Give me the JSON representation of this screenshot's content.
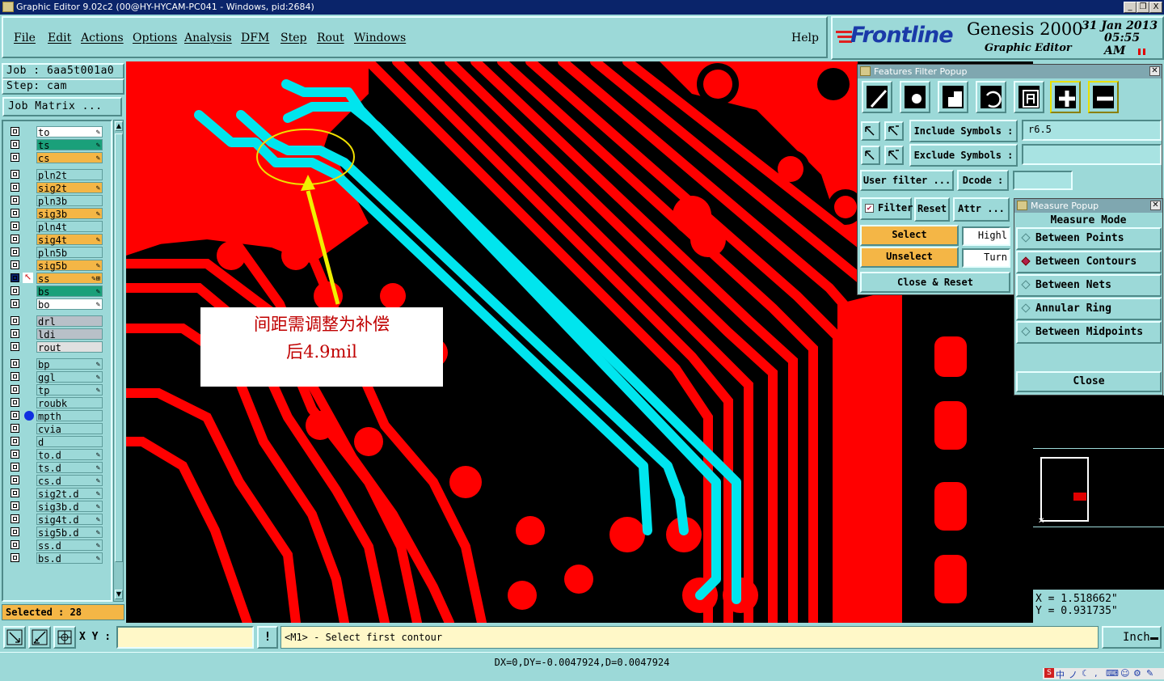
{
  "window": {
    "title": "Graphic Editor 9.02c2 (00@HY-HYCAM-PC041 - Windows, pid:2684)",
    "minimize": "_",
    "restore": "❐",
    "close": "X"
  },
  "menu": {
    "items": [
      "File",
      "Edit",
      "Actions",
      "Options",
      "Analysis",
      "DFM",
      "Step",
      "Rout",
      "Windows"
    ],
    "help": "Help"
  },
  "brand": {
    "logo": "Frontline",
    "product": "Genesis 2000",
    "subtitle": "Graphic Editor",
    "date": "31 Jan 2013",
    "time": "05:55 AM"
  },
  "left_panel": {
    "job": "Job : 6aa5t001a0",
    "step": "Step: cam",
    "job_matrix": "Job Matrix ...",
    "layers": [
      {
        "name": "to",
        "bg": "#ffffff",
        "flag": "✎"
      },
      {
        "name": "ts",
        "bg": "#1aa07a",
        "flag": "✎"
      },
      {
        "name": "cs",
        "bg": "#f4b646",
        "flag": "✎"
      },
      {
        "name": "pln2t",
        "bg": "#9cd9d8",
        "flag": ""
      },
      {
        "name": "sig2t",
        "bg": "#f4b646",
        "flag": "✎"
      },
      {
        "name": "pln3b",
        "bg": "#9cd9d8",
        "flag": ""
      },
      {
        "name": "sig3b",
        "bg": "#f4b646",
        "flag": "✎"
      },
      {
        "name": "pln4t",
        "bg": "#9cd9d8",
        "flag": ""
      },
      {
        "name": "sig4t",
        "bg": "#f4b646",
        "flag": "✎"
      },
      {
        "name": "pln5b",
        "bg": "#9cd9d8",
        "flag": ""
      },
      {
        "name": "sig5b",
        "bg": "#f4b646",
        "flag": "✎"
      },
      {
        "name": "ss",
        "bg": "#f4b646",
        "flag": "✎⊞"
      },
      {
        "name": "bs",
        "bg": "#1aa07a",
        "flag": "✎"
      },
      {
        "name": "bo",
        "bg": "#ffffff",
        "flag": "✎"
      },
      {
        "name": "drl",
        "bg": "#b8c0c8",
        "flag": ""
      },
      {
        "name": "ldi",
        "bg": "#b8c0c8",
        "flag": ""
      },
      {
        "name": "rout",
        "bg": "#e0e0e0",
        "flag": ""
      },
      {
        "name": "bp",
        "bg": "#9cd9d8",
        "flag": "✎"
      },
      {
        "name": "ggl",
        "bg": "#9cd9d8",
        "flag": "✎"
      },
      {
        "name": "tp",
        "bg": "#9cd9d8",
        "flag": "✎"
      },
      {
        "name": "roubk",
        "bg": "#9cd9d8",
        "flag": ""
      },
      {
        "name": "mpth",
        "bg": "#9cd9d8",
        "flag": ""
      },
      {
        "name": "cvia",
        "bg": "#9cd9d8",
        "flag": ""
      },
      {
        "name": "d",
        "bg": "#9cd9d8",
        "flag": ""
      },
      {
        "name": "to.d",
        "bg": "#9cd9d8",
        "flag": "✎"
      },
      {
        "name": "ts.d",
        "bg": "#9cd9d8",
        "flag": "✎"
      },
      {
        "name": "cs.d",
        "bg": "#9cd9d8",
        "flag": "✎"
      },
      {
        "name": "sig2t.d",
        "bg": "#9cd9d8",
        "flag": "✎"
      },
      {
        "name": "sig3b.d",
        "bg": "#9cd9d8",
        "flag": "✎"
      },
      {
        "name": "sig4t.d",
        "bg": "#9cd9d8",
        "flag": "✎"
      },
      {
        "name": "sig5b.d",
        "bg": "#9cd9d8",
        "flag": "✎"
      },
      {
        "name": "ss.d",
        "bg": "#9cd9d8",
        "flag": "✎"
      },
      {
        "name": "bs.d",
        "bg": "#9cd9d8",
        "flag": "✎"
      }
    ],
    "selected": "Selected : 28"
  },
  "annotation": {
    "line1": "间距需调整为补偿",
    "line2": "后4.9mil"
  },
  "features_filter": {
    "title": "Features Filter Popup",
    "include_label": "Include Symbols :",
    "include_value": "r6.5",
    "exclude_label": "Exclude Symbols :",
    "exclude_value": "",
    "user_filter": "User filter ...",
    "dcode_label": "Dcode :",
    "dcode_value": "",
    "filter": "Filter",
    "reset": "Reset",
    "attr": "Attr ...",
    "select": "Select",
    "unselect": "Unselect",
    "highlight": "Highl",
    "turn": "Turn",
    "close_reset": "Close & Reset"
  },
  "measure": {
    "title": "Measure Popup",
    "mode_label": "Measure Mode",
    "options": [
      "Between Points",
      "Between Contours",
      "Between Nets",
      "Annular Ring",
      "Between Midpoints"
    ],
    "selected_index": 1,
    "close": "Close"
  },
  "coords": {
    "x": "X = 1.518662\"",
    "y": "Y = 0.931735\""
  },
  "bottom": {
    "xy_label": "X Y :",
    "xy_value": "",
    "prompt": "<M1> - Select first contour",
    "units": "Inch",
    "status": "DX=0,DY=-0.0047924,D=0.0047924"
  },
  "colors": {
    "copper": "#ff0000",
    "selected_trace": "#00e5ee",
    "panel": "#9cd9d8",
    "title_bar": "#0a246a",
    "popup_title": "#7fa7b0"
  }
}
